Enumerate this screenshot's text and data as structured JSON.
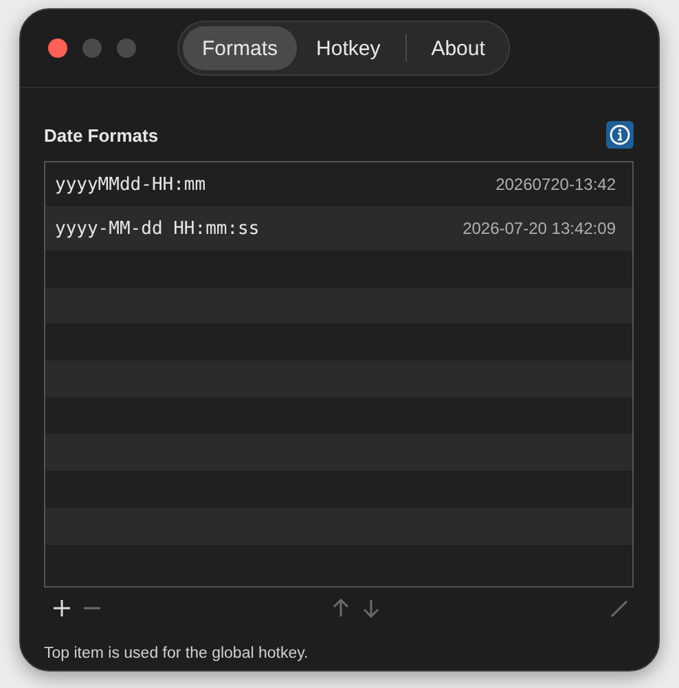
{
  "window": {
    "traffic_lights": [
      {
        "color": "#fe5f57"
      },
      {
        "color": "#4a4a4a"
      },
      {
        "color": "#4a4a4a"
      }
    ]
  },
  "tabs": [
    {
      "label": "Formats",
      "selected": true
    },
    {
      "label": "Hotkey",
      "selected": false
    },
    {
      "label": "About",
      "selected": false
    }
  ],
  "section": {
    "title": "Date Formats"
  },
  "formats": [
    {
      "pattern": "yyyyMMdd-HH:mm",
      "preview": "20260720-13:42"
    },
    {
      "pattern": "yyyy-MM-dd HH:mm:ss",
      "preview": "2026-07-20 13:42:09"
    }
  ],
  "toolbar": [
    {
      "kind": "add",
      "disabled": false
    },
    {
      "kind": "remove",
      "disabled": true
    },
    {
      "kind": "up",
      "disabled": true
    },
    {
      "kind": "down",
      "disabled": true
    },
    {
      "kind": "edit",
      "disabled": true
    }
  ],
  "footer": "Top item is used for the global hotkey."
}
